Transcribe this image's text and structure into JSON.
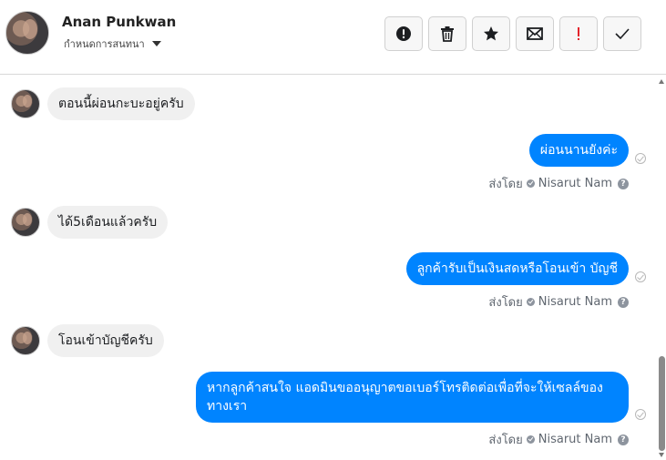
{
  "header": {
    "contact_name": "Anan Punkwan",
    "assign_label": "กำหนดการสนทนา",
    "toolbar": [
      {
        "name": "spam-button",
        "icon": "alert-circle-icon"
      },
      {
        "name": "delete-button",
        "icon": "trash-icon"
      },
      {
        "name": "star-button",
        "icon": "star-icon"
      },
      {
        "name": "mark-unread-button",
        "icon": "envelope-icon"
      },
      {
        "name": "follow-up-button",
        "icon": "exclamation-icon"
      },
      {
        "name": "done-button",
        "icon": "check-icon"
      }
    ]
  },
  "messages": [
    {
      "direction": "in",
      "text": "ตอนนี้ผ่อนกะบะอยู่ครับ"
    },
    {
      "direction": "out",
      "text": "ผ่อนนานยังค่ะ"
    },
    {
      "direction": "in",
      "text": "ได้5เดือนแล้วครับ"
    },
    {
      "direction": "out",
      "text": "ลูกค้ารับเป็นเงินสดหรือโอนเข้า บัญชี"
    },
    {
      "direction": "in",
      "text": "โอนเข้าบัญชีครับ"
    },
    {
      "direction": "out",
      "text": "หากลูกค้าสนใจ แอดมินขออนุญาตขอเบอร์โทรติดต่อเพื่อที่จะให้เซลล์ของทางเรา"
    }
  ],
  "sent_by": {
    "label": "ส่งโดย",
    "agent": "Nisarut Nam",
    "help": "?"
  },
  "colors": {
    "outgoing_bubble": "#0084ff",
    "incoming_bubble": "#f0f0f0",
    "follow_up_accent": "#e4242c"
  }
}
